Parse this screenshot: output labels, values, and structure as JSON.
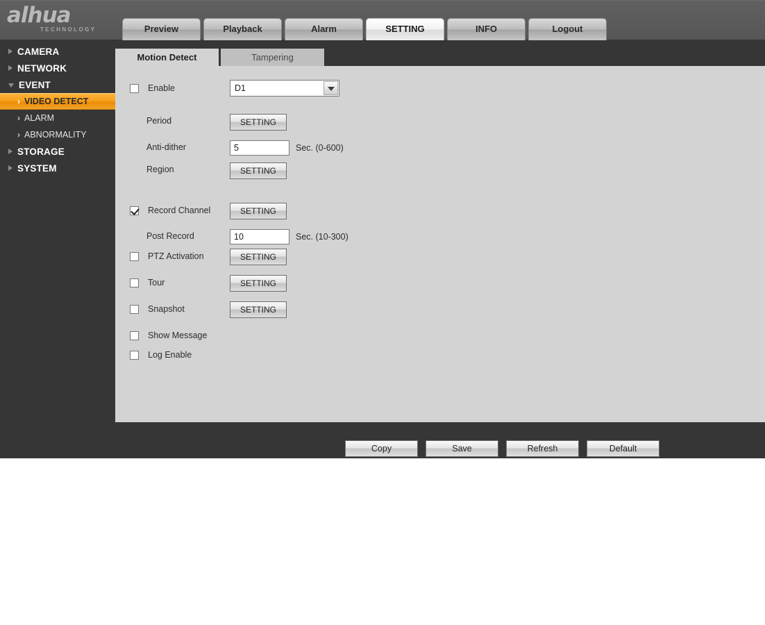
{
  "brand": {
    "logo_text": "alhua",
    "logo_sub": "TECHNOLOGY"
  },
  "nav": {
    "tabs": [
      {
        "label": "Preview",
        "active": false
      },
      {
        "label": "Playback",
        "active": false
      },
      {
        "label": "Alarm",
        "active": false
      },
      {
        "label": "SETTING",
        "active": true
      },
      {
        "label": "INFO",
        "active": false
      },
      {
        "label": "Logout",
        "active": false
      }
    ]
  },
  "sidebar": {
    "items": [
      {
        "label": "CAMERA",
        "expanded": false
      },
      {
        "label": "NETWORK",
        "expanded": false
      },
      {
        "label": "EVENT",
        "expanded": true
      }
    ],
    "event_children": [
      {
        "label": "VIDEO DETECT",
        "active": true
      },
      {
        "label": "ALARM",
        "active": false
      },
      {
        "label": "ABNORMALITY",
        "active": false
      }
    ],
    "items_tail": [
      {
        "label": "STORAGE",
        "expanded": false
      },
      {
        "label": "SYSTEM",
        "expanded": false
      }
    ]
  },
  "subtabs": [
    {
      "label": "Motion Detect",
      "active": true
    },
    {
      "label": "Tampering",
      "active": false
    }
  ],
  "form": {
    "enable": {
      "label": "Enable",
      "checked": false
    },
    "channel": {
      "value": "D1",
      "options": [
        "D1"
      ]
    },
    "period": {
      "label": "Period",
      "button": "SETTING"
    },
    "anti_dither": {
      "label": "Anti-dither",
      "value": "5",
      "unit": "Sec. (0-600)"
    },
    "region": {
      "label": "Region",
      "button": "SETTING"
    },
    "record_channel": {
      "label": "Record Channel",
      "checked": true,
      "button": "SETTING"
    },
    "post_record": {
      "label": "Post Record",
      "value": "10",
      "unit": "Sec. (10-300)"
    },
    "ptz_activation": {
      "label": "PTZ Activation",
      "checked": false,
      "button": "SETTING"
    },
    "tour": {
      "label": "Tour",
      "checked": false,
      "button": "SETTING"
    },
    "snapshot": {
      "label": "Snapshot",
      "checked": false,
      "button": "SETTING"
    },
    "show_message": {
      "label": "Show Message",
      "checked": false
    },
    "log_enable": {
      "label": "Log Enable",
      "checked": false
    }
  },
  "actions": [
    {
      "label": "Copy"
    },
    {
      "label": "Save"
    },
    {
      "label": "Refresh"
    },
    {
      "label": "Default"
    }
  ],
  "colors": {
    "header_bg": "#5b5b5b",
    "dark_bg": "#363636",
    "content_bg": "#d3d3d4",
    "accent_orange": "#f0a31e"
  }
}
